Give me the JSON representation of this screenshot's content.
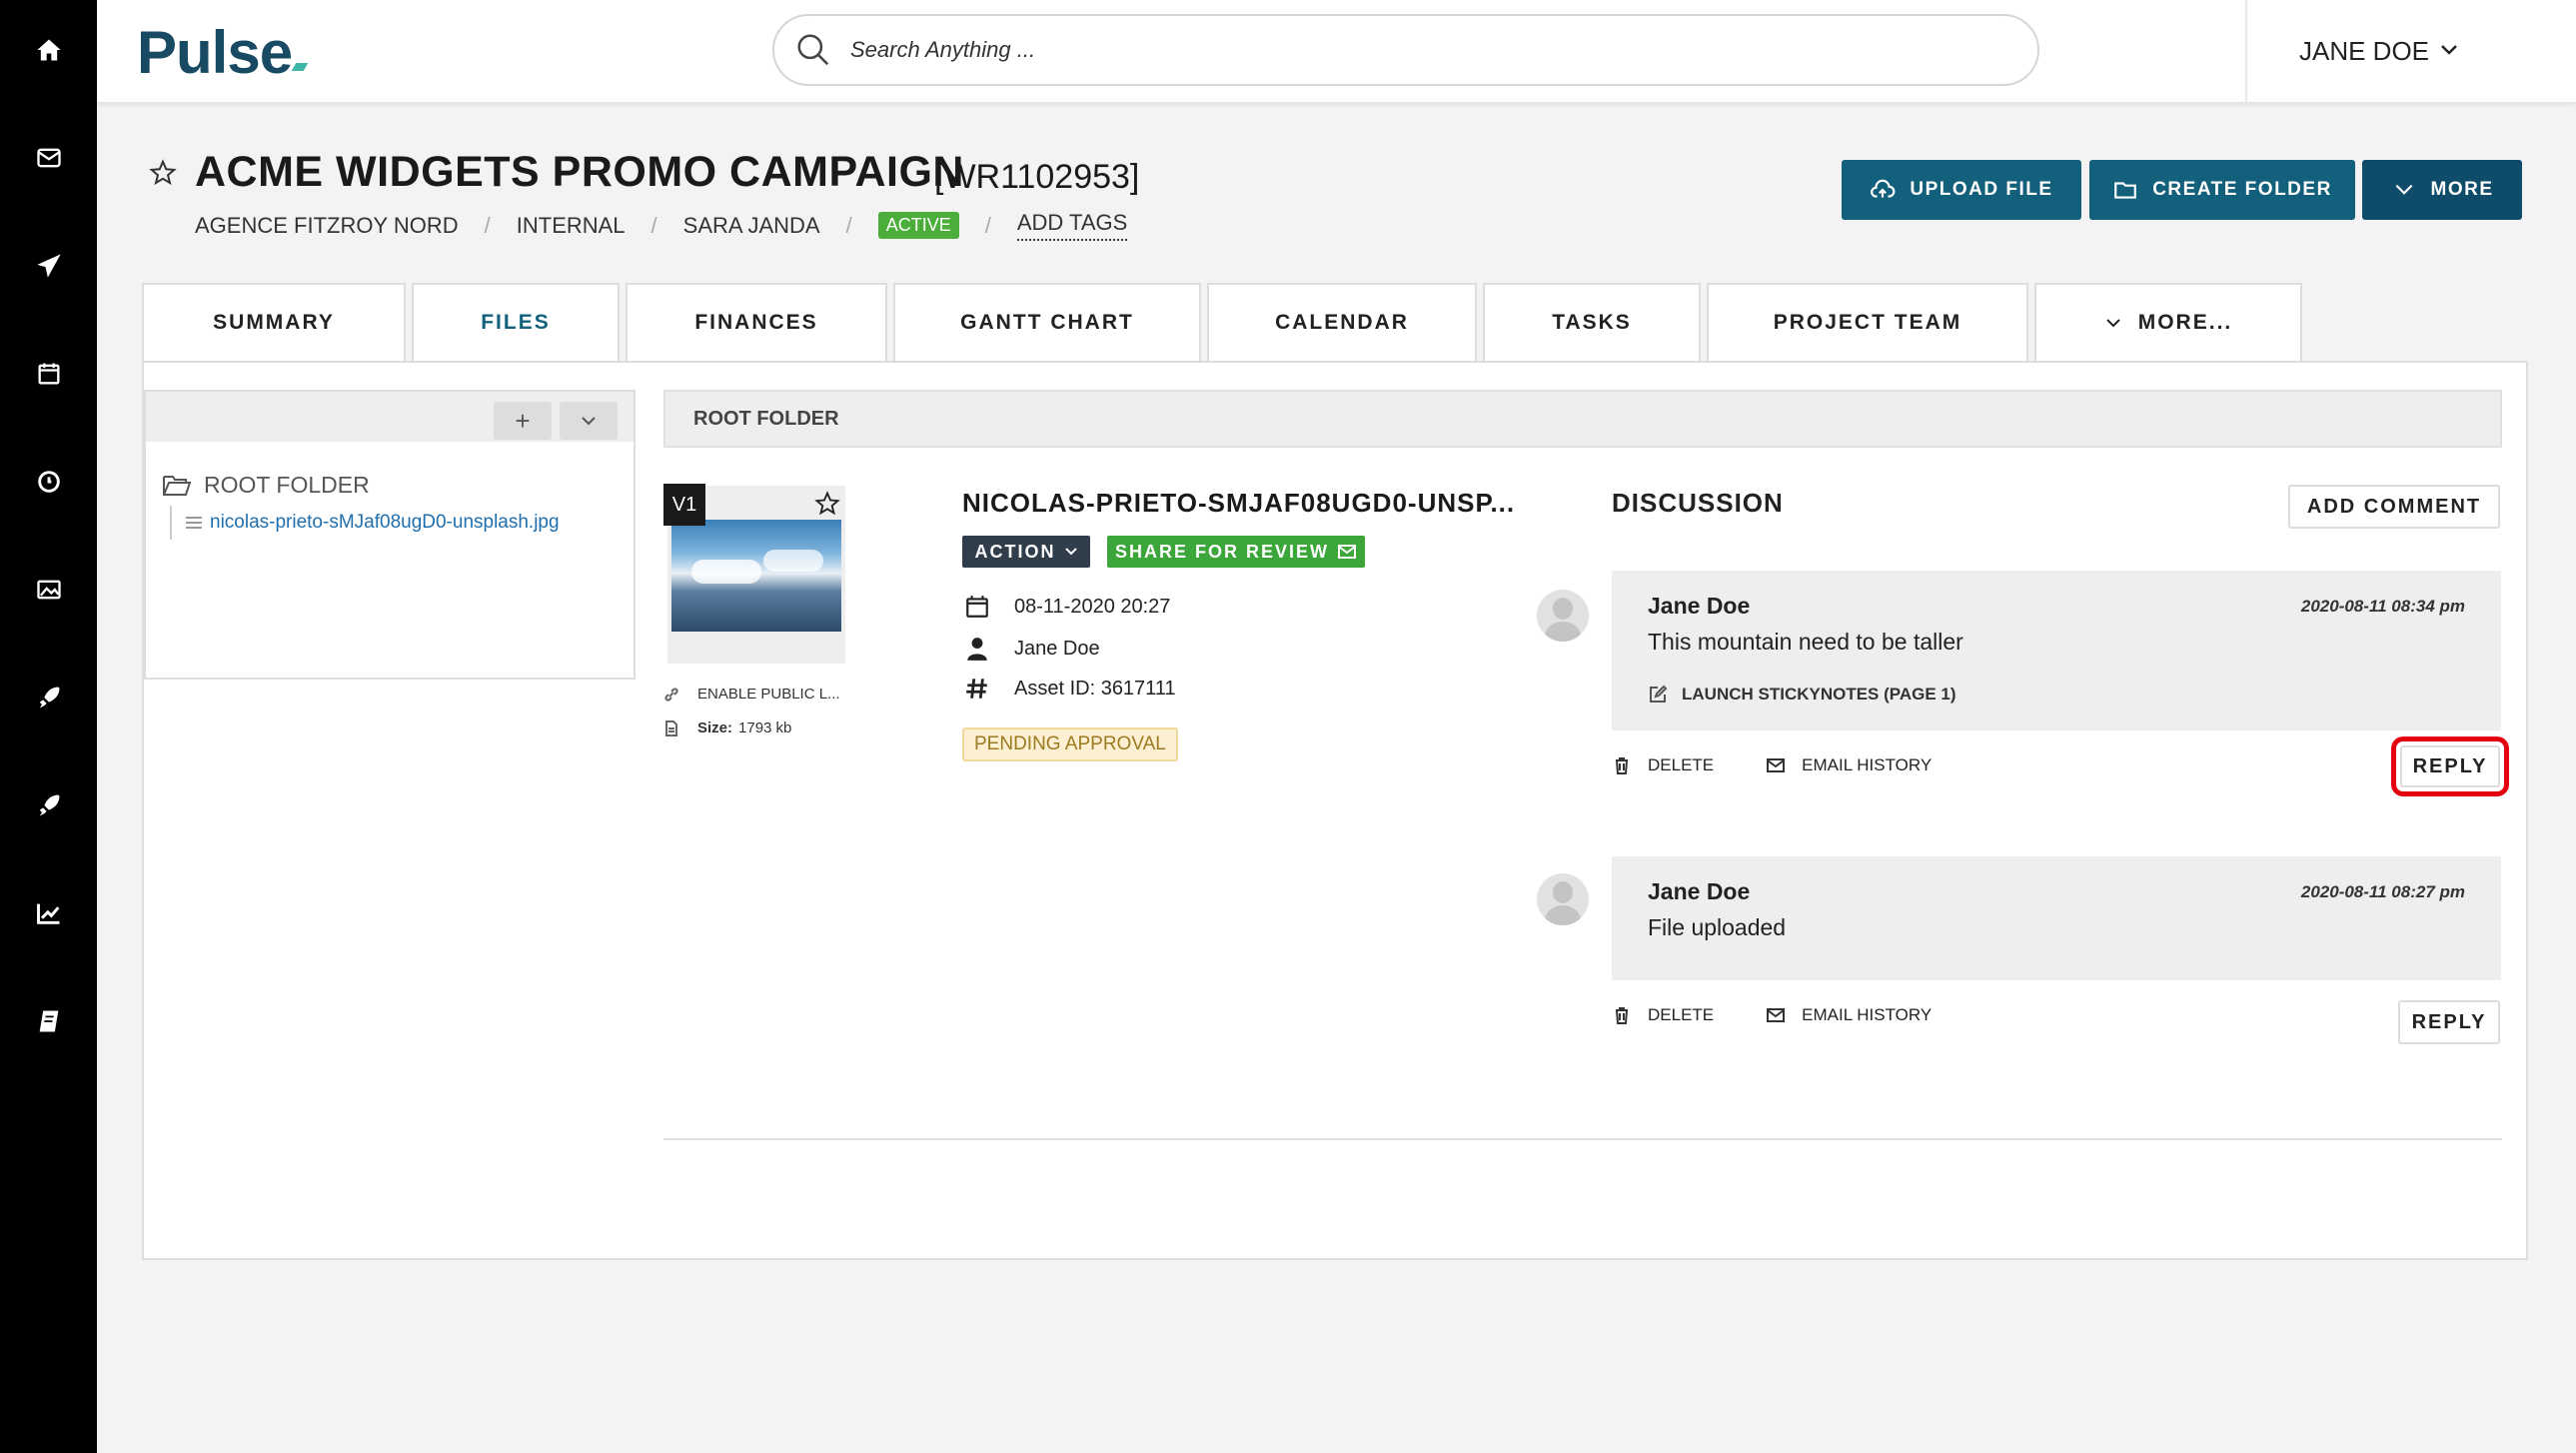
{
  "app": {
    "logo": "Pulse"
  },
  "search": {
    "placeholder": "Search Anything ..."
  },
  "user": {
    "name": "JANE DOE",
    "chevron": "⌄"
  },
  "rail": [
    {
      "icon": "home-icon"
    },
    {
      "icon": "mail-icon"
    },
    {
      "icon": "send-icon"
    },
    {
      "icon": "calendar-icon"
    },
    {
      "icon": "clock-icon"
    },
    {
      "icon": "image-icon"
    },
    {
      "icon": "rocket-icon"
    },
    {
      "icon": "rocket-icon"
    },
    {
      "icon": "chart-icon"
    },
    {
      "icon": "book-icon"
    }
  ],
  "project": {
    "title": "ACME WIDGETS PROMO CAMPAIGN",
    "code": "[WR1102953]",
    "breadcrumbs": [
      "AGENCE FITZROY NORD",
      "INTERNAL",
      "SARA JANDA"
    ],
    "separator": "/",
    "status": "ACTIVE",
    "add_tags": "ADD TAGS"
  },
  "actions": {
    "upload": "UPLOAD FILE",
    "create_folder": "CREATE FOLDER",
    "more": "MORE"
  },
  "tabs": [
    {
      "label": "SUMMARY"
    },
    {
      "label": "FILES",
      "active": true
    },
    {
      "label": "FINANCES"
    },
    {
      "label": "GANTT CHART"
    },
    {
      "label": "CALENDAR"
    },
    {
      "label": "TASKS"
    },
    {
      "label": "PROJECT TEAM"
    },
    {
      "label": "MORE..."
    }
  ],
  "tree": {
    "add": "+",
    "toggle": "⌄",
    "root": "ROOT FOLDER",
    "file": "nicolas-prieto-sMJaf08ugD0-unsplash.jpg"
  },
  "folder_bar": "ROOT FOLDER",
  "file": {
    "version": "V1",
    "title": "NICOLAS-PRIETO-SMJAF08UGD0-UNSP...",
    "action_label": "ACTION",
    "share_label": "SHARE FOR REVIEW",
    "date": "08-11-2020 20:27",
    "owner": "Jane Doe",
    "asset_id": "Asset ID: 3617111",
    "status": "PENDING APPROVAL",
    "public_link": "ENABLE PUBLIC L...",
    "size_label": "Size:",
    "size_value": "1793 kb"
  },
  "discussion": {
    "title": "DISCUSSION",
    "add_comment": "ADD COMMENT",
    "delete_label": "DELETE",
    "email_history_label": "EMAIL HISTORY",
    "reply_label": "REPLY",
    "comments": [
      {
        "author": "Jane Doe",
        "time": "2020-08-11 08:34 pm",
        "text": "This mountain need to be taller",
        "link": "LAUNCH STICKYNOTES (PAGE 1)"
      },
      {
        "author": "Jane Doe",
        "time": "2020-08-11 08:27 pm",
        "text": "File uploaded"
      }
    ]
  }
}
